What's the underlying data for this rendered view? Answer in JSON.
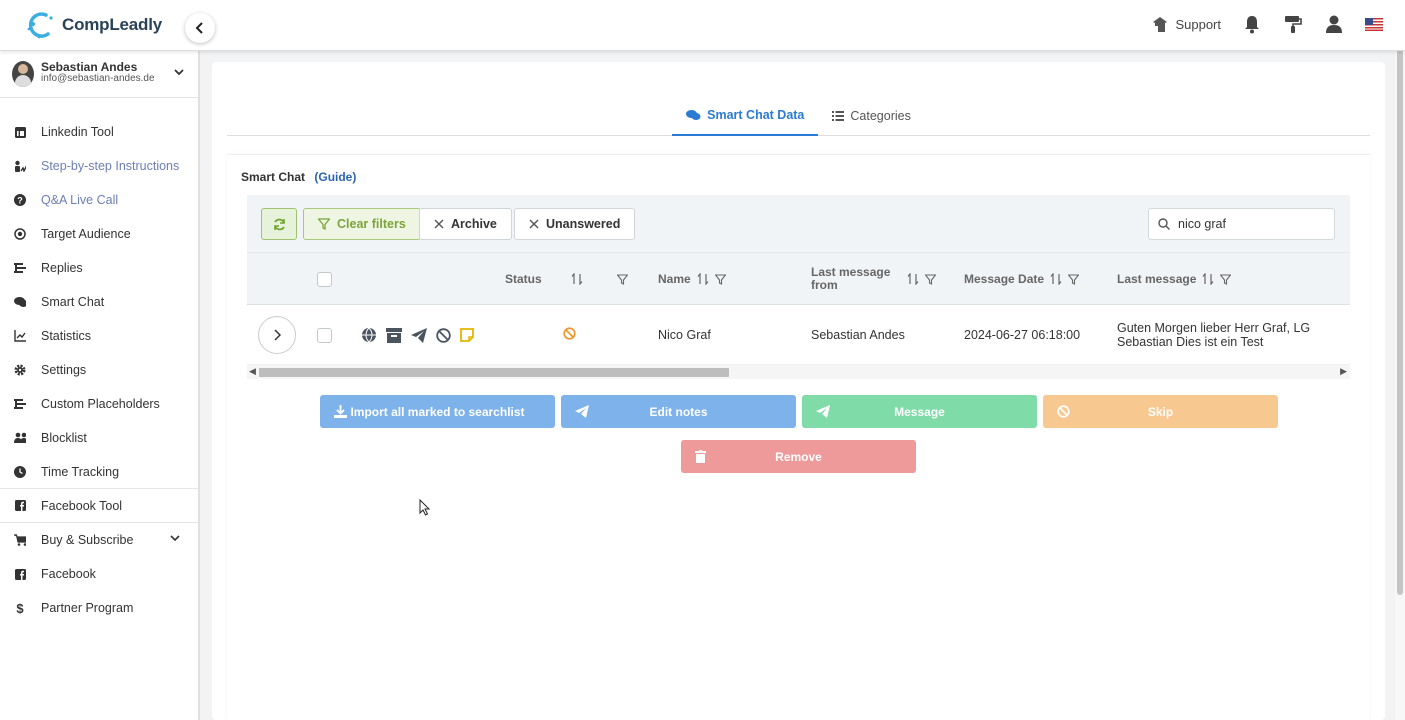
{
  "app": {
    "logo_text": "CompLeadly",
    "brand_color": "#2b7bd4"
  },
  "topbar": {
    "support_label": "Support",
    "icons": [
      "support-icon",
      "bell-icon",
      "paint-roller-icon",
      "user-icon",
      "us-flag-icon"
    ]
  },
  "user": {
    "name": "Sebastian Andes",
    "email": "info@sebastian-andes.de"
  },
  "sidebar": {
    "items": [
      {
        "label": "Linkedin Tool",
        "icon": "linkedin-icon"
      },
      {
        "label": "Step-by-step Instructions",
        "icon": "instructions-icon"
      },
      {
        "label": "Q&A Live Call",
        "icon": "question-icon"
      },
      {
        "label": "Target Audience",
        "icon": "target-icon"
      },
      {
        "label": "Replies",
        "icon": "replies-icon"
      },
      {
        "label": "Smart Chat",
        "icon": "chat-icon"
      },
      {
        "label": "Statistics",
        "icon": "statistics-icon"
      },
      {
        "label": "Settings",
        "icon": "gear-icon"
      },
      {
        "label": "Custom Placeholders",
        "icon": "placeholders-icon"
      },
      {
        "label": "Blocklist",
        "icon": "blocklist-icon"
      },
      {
        "label": "Time Tracking",
        "icon": "clock-icon"
      },
      {
        "label": "Facebook Tool",
        "icon": "facebook-icon"
      },
      {
        "label": "Buy & Subscribe",
        "icon": "cart-icon"
      },
      {
        "label": "Facebook",
        "icon": "facebook-icon"
      },
      {
        "label": "Partner Program",
        "icon": "dollar-icon"
      }
    ]
  },
  "tabs": [
    {
      "label": "Smart Chat Data",
      "active": true
    },
    {
      "label": "Categories",
      "active": false
    }
  ],
  "card": {
    "title": "Smart Chat",
    "guide_link": "(Guide)"
  },
  "toolbar": {
    "clear_filters": "Clear filters",
    "archive": "Archive",
    "unanswered": "Unanswered",
    "search_value": "nico graf"
  },
  "table": {
    "headers": {
      "status": "Status",
      "name": "Name",
      "last_message_from": "Last message from",
      "message_date": "Message Date",
      "last_message": "Last message"
    },
    "rows": [
      {
        "name": "Nico Graf",
        "last_message_from": "Sebastian Andes",
        "message_date": "2024-06-27 06:18:00",
        "last_message": "Guten Morgen lieber Herr Graf, LG Sebastian Dies ist ein Test"
      }
    ]
  },
  "actions": {
    "import": "Import all marked to searchlist",
    "edit_notes": "Edit notes",
    "message": "Message",
    "skip": "Skip",
    "remove": "Remove"
  },
  "colors": {
    "import": "#7db2eb",
    "message": "#7fdba7",
    "skip": "#f8c891",
    "remove": "#ef9a9a",
    "clear_filters": "#7ca43b"
  }
}
